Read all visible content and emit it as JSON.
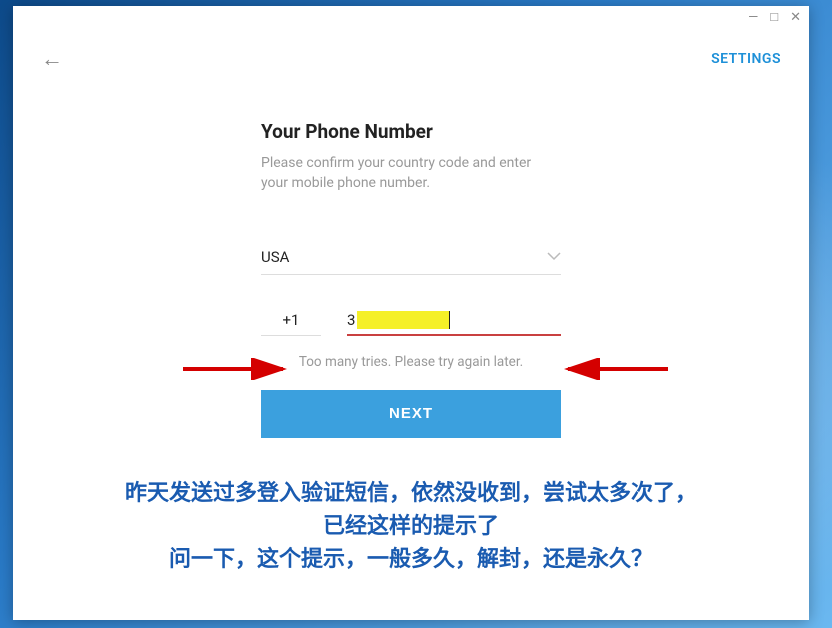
{
  "window": {
    "minimize": "—",
    "maximize": "□",
    "close": "✕"
  },
  "header": {
    "back": "←",
    "settings": "SETTINGS"
  },
  "form": {
    "title": "Your Phone Number",
    "subtitle": "Please confirm your country code and enter your mobile phone number.",
    "country": "USA",
    "dial_code": "+1",
    "phone_prefix": "3",
    "error": "Too many tries. Please try again later.",
    "next": "NEXT"
  },
  "annotation": {
    "line1": "昨天发送过多登入验证短信，依然没收到，尝试太多次了，",
    "line2": "已经这样的提示了",
    "line3": "问一下，这个提示，一般多久，解封，还是永久？"
  }
}
